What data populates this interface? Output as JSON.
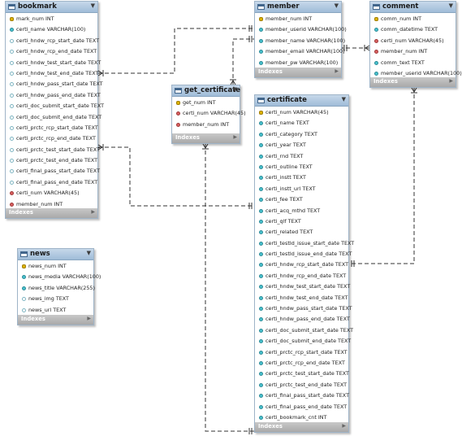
{
  "tables": [
    {
      "id": "bookmark",
      "name": "bookmark",
      "columns": [
        {
          "text": "mark_num INT",
          "icon": "pk"
        },
        {
          "text": "certi_name VARCHAR(100)",
          "icon": "nn"
        },
        {
          "text": "certi_hndw_rcp_start_date TEXT",
          "icon": "col"
        },
        {
          "text": "certi_hndw_rcp_end_date TEXT",
          "icon": "col"
        },
        {
          "text": "certi_hndw_test_start_date TEXT",
          "icon": "col"
        },
        {
          "text": "certi_hndw_test_end_date TEXT",
          "icon": "col"
        },
        {
          "text": "certi_hndw_pass_start_date TEXT",
          "icon": "col"
        },
        {
          "text": "certi_hndw_pass_end_date TEXT",
          "icon": "col"
        },
        {
          "text": "certi_doc_submit_start_date TEXT",
          "icon": "col"
        },
        {
          "text": "certi_doc_submit_end_date TEXT",
          "icon": "col"
        },
        {
          "text": "certi_prctc_rcp_start_date TEXT",
          "icon": "col"
        },
        {
          "text": "certi_prctc_rcp_end_date TEXT",
          "icon": "col"
        },
        {
          "text": "certi_prctc_test_start_date TEXT",
          "icon": "col"
        },
        {
          "text": "certi_prctc_test_end_date TEXT",
          "icon": "col"
        },
        {
          "text": "certi_final_pass_start_date TEXT",
          "icon": "col"
        },
        {
          "text": "certi_final_pass_end_date TEXT",
          "icon": "col"
        },
        {
          "text": "certi_num VARCHAR(45)",
          "icon": "fk"
        },
        {
          "text": "member_num INT",
          "icon": "fk"
        }
      ],
      "footer": "Indexes"
    },
    {
      "id": "member",
      "name": "member",
      "columns": [
        {
          "text": "member_num INT",
          "icon": "pk"
        },
        {
          "text": "member_userid VARCHAR(100)",
          "icon": "nn"
        },
        {
          "text": "member_name VARCHAR(100)",
          "icon": "nn"
        },
        {
          "text": "member_email VARCHAR(100)",
          "icon": "nn"
        },
        {
          "text": "member_pw VARCHAR(100)",
          "icon": "nn"
        }
      ],
      "footer": "Indexes"
    },
    {
      "id": "comment",
      "name": "comment",
      "columns": [
        {
          "text": "comm_num INT",
          "icon": "pk"
        },
        {
          "text": "comm_datetime TEXT",
          "icon": "nn"
        },
        {
          "text": "certi_num VARCHAR(45)",
          "icon": "fk"
        },
        {
          "text": "member_num INT",
          "icon": "fk"
        },
        {
          "text": "comm_text TEXT",
          "icon": "nn"
        },
        {
          "text": "member_userid VARCHAR(100)",
          "icon": "nn"
        }
      ],
      "footer": "Indexes"
    },
    {
      "id": "get_certificate",
      "name": "get_certificate",
      "columns": [
        {
          "text": "get_num INT",
          "icon": "pk"
        },
        {
          "text": "certi_num VARCHAR(45)",
          "icon": "fk"
        },
        {
          "text": "member_num INT",
          "icon": "fk"
        }
      ],
      "footer": "Indexes"
    },
    {
      "id": "certificate",
      "name": "certificate",
      "columns": [
        {
          "text": "certi_num VARCHAR(45)",
          "icon": "pk"
        },
        {
          "text": "certi_name TEXT",
          "icon": "nn"
        },
        {
          "text": "certi_category TEXT",
          "icon": "nn"
        },
        {
          "text": "certi_year TEXT",
          "icon": "nn"
        },
        {
          "text": "certi_rnd TEXT",
          "icon": "nn"
        },
        {
          "text": "certi_outline TEXT",
          "icon": "nn"
        },
        {
          "text": "certi_instt TEXT",
          "icon": "nn"
        },
        {
          "text": "certi_instt_url TEXT",
          "icon": "nn"
        },
        {
          "text": "certi_fee TEXT",
          "icon": "nn"
        },
        {
          "text": "certi_acq_mthd TEXT",
          "icon": "nn"
        },
        {
          "text": "certi_qlf TEXT",
          "icon": "nn"
        },
        {
          "text": "certi_related TEXT",
          "icon": "nn"
        },
        {
          "text": "certi_testId_issue_start_date TEXT",
          "icon": "nn"
        },
        {
          "text": "certi_testId_issue_end_date TEXT",
          "icon": "nn"
        },
        {
          "text": "certi_hndw_rcp_start_date TEXT",
          "icon": "nn"
        },
        {
          "text": "certi_hndw_rcp_end_date TEXT",
          "icon": "nn"
        },
        {
          "text": "certi_hndw_test_start_date TEXT",
          "icon": "nn"
        },
        {
          "text": "certi_hndw_test_end_date TEXT",
          "icon": "nn"
        },
        {
          "text": "certi_hndw_pass_start_date TEXT",
          "icon": "nn"
        },
        {
          "text": "certi_hndw_pass_end_date TEXT",
          "icon": "nn"
        },
        {
          "text": "certi_doc_submit_start_date TEXT",
          "icon": "nn"
        },
        {
          "text": "certi_doc_submit_end_date TEXT",
          "icon": "nn"
        },
        {
          "text": "certi_prctc_rcp_start_date TEXT",
          "icon": "nn"
        },
        {
          "text": "certi_prctc_rcp_end_date TEXT",
          "icon": "nn"
        },
        {
          "text": "certi_prctc_test_start_date TEXT",
          "icon": "nn"
        },
        {
          "text": "certi_prctc_test_end_date TEXT",
          "icon": "nn"
        },
        {
          "text": "certi_final_pass_start_date TEXT",
          "icon": "nn"
        },
        {
          "text": "certi_final_pass_end_date TEXT",
          "icon": "nn"
        },
        {
          "text": "certi_bookmark_cnt INT",
          "icon": "nn"
        }
      ],
      "footer": "Indexes"
    },
    {
      "id": "news",
      "name": "news",
      "columns": [
        {
          "text": "news_num INT",
          "icon": "pk"
        },
        {
          "text": "news_media VARCHAR(100)",
          "icon": "nn"
        },
        {
          "text": "news_title VARCHAR(255)",
          "icon": "nn"
        },
        {
          "text": "news_img TEXT",
          "icon": "col"
        },
        {
          "text": "news_url TEXT",
          "icon": "col"
        }
      ],
      "footer": "Indexes"
    }
  ],
  "relationships": [
    {
      "from": "bookmark",
      "to": "member",
      "style": "dashed"
    },
    {
      "from": "bookmark",
      "to": "certificate",
      "style": "dashed"
    },
    {
      "from": "get_certificate",
      "to": "member",
      "style": "dashed"
    },
    {
      "from": "get_certificate",
      "to": "certificate",
      "style": "dashed"
    },
    {
      "from": "comment",
      "to": "member",
      "style": "dashed"
    },
    {
      "from": "comment",
      "to": "certificate",
      "style": "dashed"
    }
  ],
  "colors": {
    "header": "#a9c4de",
    "footer": "#b3b3b3",
    "primary_key": "#e0b500",
    "foreign_key": "#d86060",
    "not_null": "#49c2cf",
    "line": "#333333"
  }
}
